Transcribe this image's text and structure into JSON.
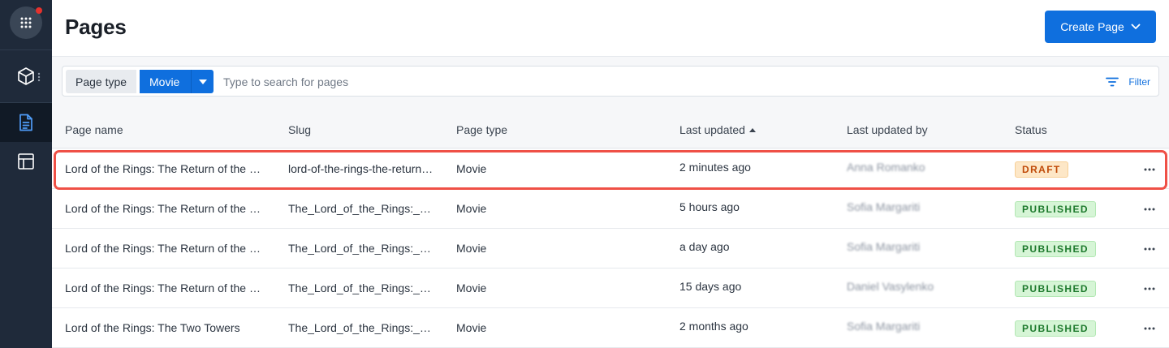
{
  "sidebar": {
    "items": [
      {
        "icon": "apps-grid-icon"
      },
      {
        "icon": "cube-icon"
      },
      {
        "icon": "document-icon",
        "active": true
      },
      {
        "icon": "layout-icon"
      }
    ]
  },
  "header": {
    "title": "Pages",
    "create_label": "Create Page"
  },
  "search": {
    "page_type_label": "Page type",
    "page_type_value": "Movie",
    "placeholder": "Type to search for pages",
    "filter_label": "Filter"
  },
  "table": {
    "columns": [
      "Page name",
      "Slug",
      "Page type",
      "Last updated",
      "Last updated by",
      "Status"
    ],
    "sort_column": "Last updated",
    "sort_direction": "ascending",
    "rows": [
      {
        "name": "Lord of the Rings: The Return of the King",
        "slug": "lord-of-the-rings-the-return-of-the-king",
        "type": "Movie",
        "updated": "2 minutes ago",
        "by": "Anna Romanko",
        "status": "DRAFT",
        "highlighted": true
      },
      {
        "name": "Lord of the Rings: The Return of the King",
        "slug": "The_Lord_of_the_Rings:_The_Return_of_the_King",
        "type": "Movie",
        "updated": "5 hours ago",
        "by": "Sofia Margariti",
        "status": "PUBLISHED"
      },
      {
        "name": "Lord of the Rings: The Return of the King",
        "slug": "The_Lord_of_the_Rings:_The_Return_of_the_King",
        "type": "Movie",
        "updated": "a day ago",
        "by": "Sofia Margariti",
        "status": "PUBLISHED"
      },
      {
        "name": "Lord of the Rings: The Return of the King",
        "slug": "The_Lord_of_the_Rings:_The_Return_of_the_King",
        "type": "Movie",
        "updated": "15 days ago",
        "by": "Daniel Vasylenko",
        "status": "PUBLISHED"
      },
      {
        "name": "Lord of the Rings: The Two Towers",
        "slug": "The_Lord_of_the_Rings:_The_Two_Towers",
        "type": "Movie",
        "updated": "2 months ago",
        "by": "Sofia Margariti",
        "status": "PUBLISHED"
      }
    ]
  },
  "colors": {
    "accent": "#0f6fde",
    "sidebar_bg": "#1f2a3a",
    "highlight": "#ef5046",
    "draft_bg": "#fde7c7",
    "draft_text": "#c04a09",
    "published_bg": "#d6f5d6",
    "published_text": "#1e7a2d"
  }
}
